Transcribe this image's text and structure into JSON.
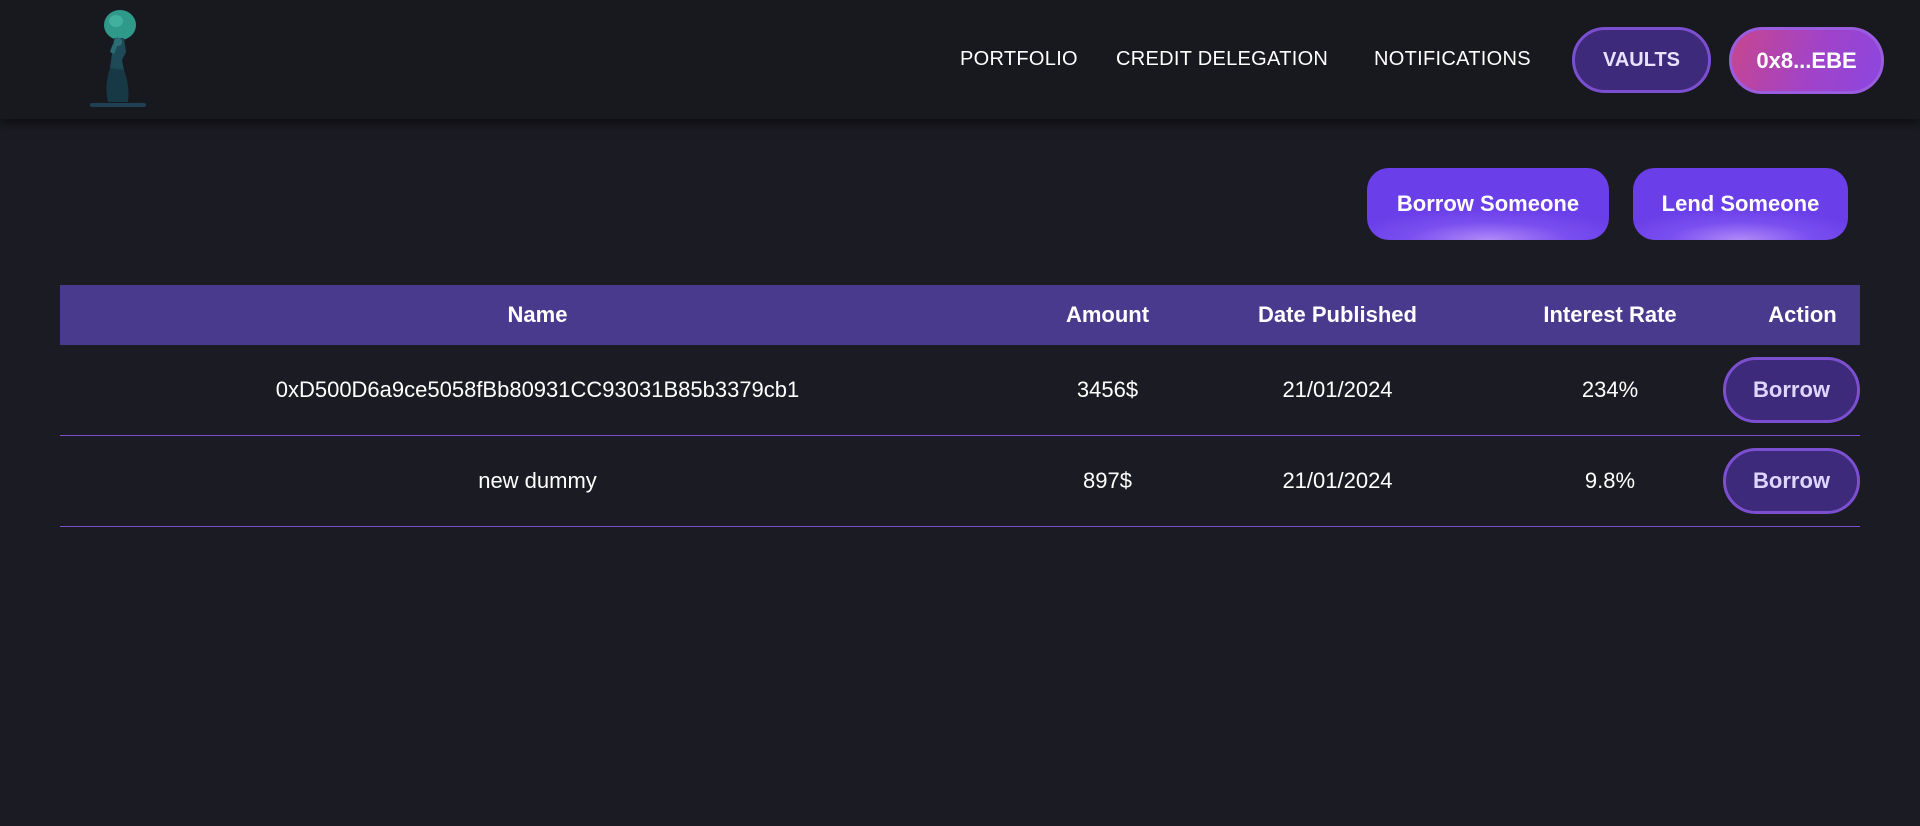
{
  "nav": {
    "logo_icon": "figure-with-globe-logo",
    "links": [
      "PORTFOLIO",
      "CREDIT DELEGATION",
      "NOTIFICATIONS"
    ],
    "vaults_label": "VAULTS",
    "wallet_label": "0x8...EBE"
  },
  "actions": {
    "borrow_someone": "Borrow Someone",
    "lend_someone": "Lend Someone"
  },
  "table": {
    "headers": [
      "Name",
      "Amount",
      "Date Published",
      "Interest Rate",
      "Action"
    ],
    "rows": [
      {
        "name": "0xD500D6a9ce5058fBb80931CC93031B85b3379cb1",
        "amount": "3456$",
        "date": "21/01/2024",
        "rate": "234%",
        "action": "Borrow"
      },
      {
        "name": "new dummy",
        "amount": "897$",
        "date": "21/01/2024",
        "rate": "9.8%",
        "action": "Borrow"
      }
    ]
  },
  "colors": {
    "background": "#1b1b23",
    "navbar": "#18181f",
    "table_header": "#4a3a8e",
    "accent": "#7a4ff0",
    "row_divider": "#7a4fc8"
  }
}
